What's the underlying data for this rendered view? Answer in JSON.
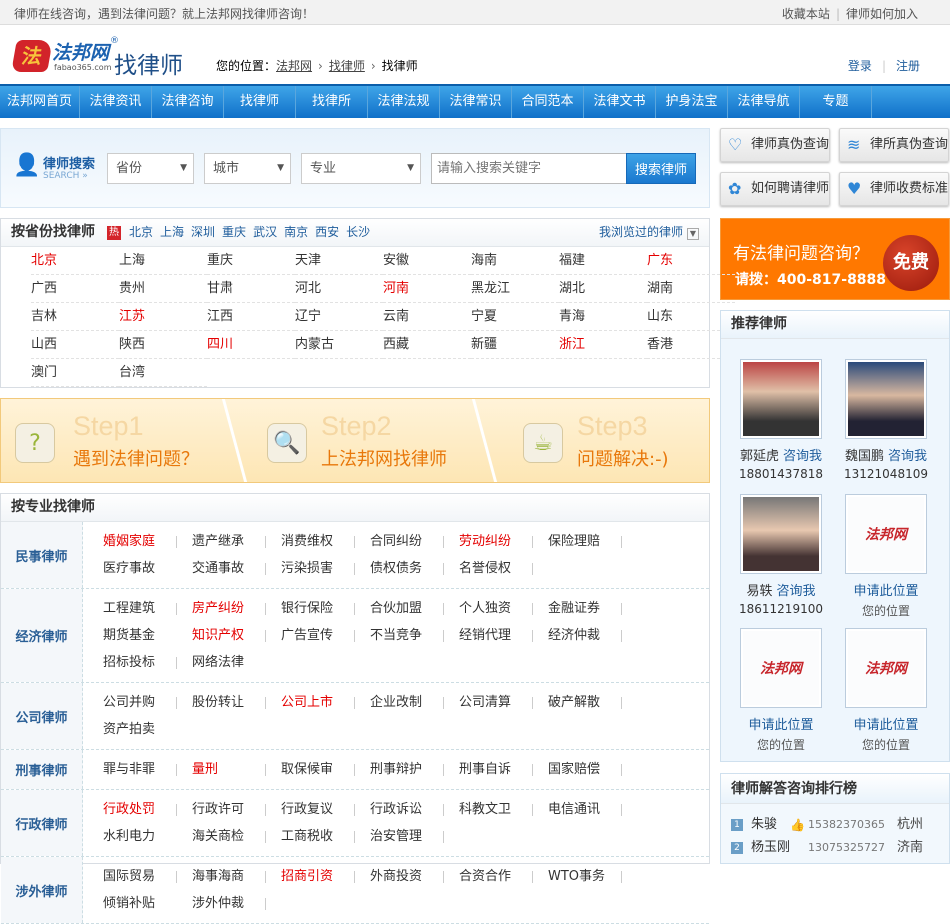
{
  "topbar": {
    "slogan": "律师在线咨询，遇到法律问题？就上法邦网找律师咨询！",
    "links": [
      "收藏本站",
      "律师如何加入"
    ]
  },
  "logo": {
    "brand": "法邦网",
    "domain": "fabao365.com",
    "reg": "®",
    "section": "找律师"
  },
  "breadcrumb": {
    "label": "您的位置：",
    "items": [
      "法邦网",
      "找律师",
      "找律师"
    ]
  },
  "auth": {
    "login": "登录",
    "register": "注册"
  },
  "nav": [
    "法邦网首页",
    "法律资讯",
    "法律咨询",
    "找律师",
    "找律所",
    "法律法规",
    "法律常识",
    "合同范本",
    "法律文书",
    "护身法宝",
    "法律导航",
    "专题"
  ],
  "search": {
    "title": "律师搜索",
    "sub": "SEARCH »",
    "province": "省份",
    "city": "城市",
    "specialty": "专业",
    "placeholder": "请输入搜索关键字",
    "button": "搜索律师"
  },
  "quick": [
    "律师真伪查询",
    "律所真伪查询",
    "如何聘请律师",
    "律师收费标准"
  ],
  "free": {
    "line1": "有法律问题咨询？",
    "line2": "请拨：400-817-8888",
    "badge": "免费"
  },
  "provinces": {
    "title": "按省份找律师",
    "hot": "热",
    "hot_cities": [
      "北京",
      "上海",
      "深圳",
      "重庆",
      "武汉",
      "南京",
      "西安",
      "长沙"
    ],
    "history": "我浏览过的律师",
    "items": [
      {
        "n": "北京",
        "r": true
      },
      {
        "n": "上海"
      },
      {
        "n": "重庆"
      },
      {
        "n": "天津"
      },
      {
        "n": "安徽"
      },
      {
        "n": "海南"
      },
      {
        "n": "福建"
      },
      {
        "n": "广东",
        "r": true
      },
      {
        "n": "广西"
      },
      {
        "n": "贵州"
      },
      {
        "n": "甘肃"
      },
      {
        "n": "河北"
      },
      {
        "n": "河南",
        "r": true
      },
      {
        "n": "黑龙江"
      },
      {
        "n": "湖北"
      },
      {
        "n": "湖南"
      },
      {
        "n": "吉林"
      },
      {
        "n": "江苏",
        "r": true
      },
      {
        "n": "江西"
      },
      {
        "n": "辽宁"
      },
      {
        "n": "云南"
      },
      {
        "n": "宁夏"
      },
      {
        "n": "青海"
      },
      {
        "n": "山东"
      },
      {
        "n": "山西"
      },
      {
        "n": "陕西"
      },
      {
        "n": "四川",
        "r": true
      },
      {
        "n": "内蒙古"
      },
      {
        "n": "西藏"
      },
      {
        "n": "新疆"
      },
      {
        "n": "浙江",
        "r": true
      },
      {
        "n": "香港"
      },
      {
        "n": "澳门"
      },
      {
        "n": "台湾"
      }
    ]
  },
  "steps": [
    {
      "n": "Step1",
      "t": "遇到法律问题？"
    },
    {
      "n": "Step2",
      "t": "上法邦网找律师"
    },
    {
      "n": "Step3",
      "t": "问题解决:-)"
    }
  ],
  "specialty": {
    "title": "按专业找律师",
    "rows": [
      {
        "cat": "民事律师",
        "items": [
          {
            "n": "婚姻家庭",
            "r": true
          },
          {
            "n": "遗产继承"
          },
          {
            "n": "消费维权"
          },
          {
            "n": "合同纠纷"
          },
          {
            "n": "劳动纠纷",
            "r": true
          },
          {
            "n": "保险理赔"
          },
          {
            "n": "医疗事故"
          },
          {
            "n": "交通事故"
          },
          {
            "n": "污染损害"
          },
          {
            "n": "债权债务"
          },
          {
            "n": "名誉侵权"
          }
        ]
      },
      {
        "cat": "经济律师",
        "items": [
          {
            "n": "工程建筑"
          },
          {
            "n": "房产纠纷",
            "r": true
          },
          {
            "n": "银行保险"
          },
          {
            "n": "合伙加盟"
          },
          {
            "n": "个人独资"
          },
          {
            "n": "金融证券"
          },
          {
            "n": "期货基金"
          },
          {
            "n": "知识产权",
            "r": true
          },
          {
            "n": "广告宣传"
          },
          {
            "n": "不当竞争"
          },
          {
            "n": "经销代理"
          },
          {
            "n": "经济仲裁"
          },
          {
            "n": "招标投标"
          },
          {
            "n": "网络法律"
          }
        ]
      },
      {
        "cat": "公司律师",
        "items": [
          {
            "n": "公司并购"
          },
          {
            "n": "股份转让"
          },
          {
            "n": "公司上市",
            "r": true
          },
          {
            "n": "企业改制"
          },
          {
            "n": "公司清算"
          },
          {
            "n": "破产解散"
          },
          {
            "n": "资产拍卖"
          }
        ]
      },
      {
        "cat": "刑事律师",
        "items": [
          {
            "n": "罪与非罪"
          },
          {
            "n": "量刑",
            "r": true
          },
          {
            "n": "取保候审"
          },
          {
            "n": "刑事辩护"
          },
          {
            "n": "刑事自诉"
          },
          {
            "n": "国家赔偿"
          }
        ]
      },
      {
        "cat": "行政律师",
        "items": [
          {
            "n": "行政处罚",
            "r": true
          },
          {
            "n": "行政许可"
          },
          {
            "n": "行政复议"
          },
          {
            "n": "行政诉讼"
          },
          {
            "n": "科教文卫"
          },
          {
            "n": "电信通讯"
          },
          {
            "n": "水利电力"
          },
          {
            "n": "海关商检"
          },
          {
            "n": "工商税收"
          },
          {
            "n": "治安管理"
          }
        ]
      },
      {
        "cat": "涉外律师",
        "items": [
          {
            "n": "国际贸易"
          },
          {
            "n": "海事海商"
          },
          {
            "n": "招商引资",
            "r": true
          },
          {
            "n": "外商投资"
          },
          {
            "n": "合资合作"
          },
          {
            "n": "WTO事务"
          },
          {
            "n": "倾销补贴"
          },
          {
            "n": "涉外仲裁"
          }
        ]
      }
    ]
  },
  "recommend": {
    "title": "推荐律师",
    "consult": "咨询我",
    "lawyers": [
      {
        "name": "郭延虎",
        "tel": "18801437818"
      },
      {
        "name": "魏国鹏",
        "tel": "13121048109"
      },
      {
        "name": "易轶",
        "tel": "18611219100"
      }
    ],
    "apply": "申请此位置",
    "yours": "您的位置",
    "placeholder_logo": "法邦网"
  },
  "ranking": {
    "title": "律师解答咨询排行榜",
    "rows": [
      {
        "no": "1",
        "name": "朱骏",
        "tel": "15382370365",
        "city": "杭州"
      },
      {
        "no": "2",
        "name": "杨玉刚",
        "tel": "13075325727",
        "city": "济南"
      }
    ]
  },
  "colors": {
    "brand_blue": "#1070c9",
    "accent_red": "#e40000",
    "orange": "#ff7800"
  }
}
